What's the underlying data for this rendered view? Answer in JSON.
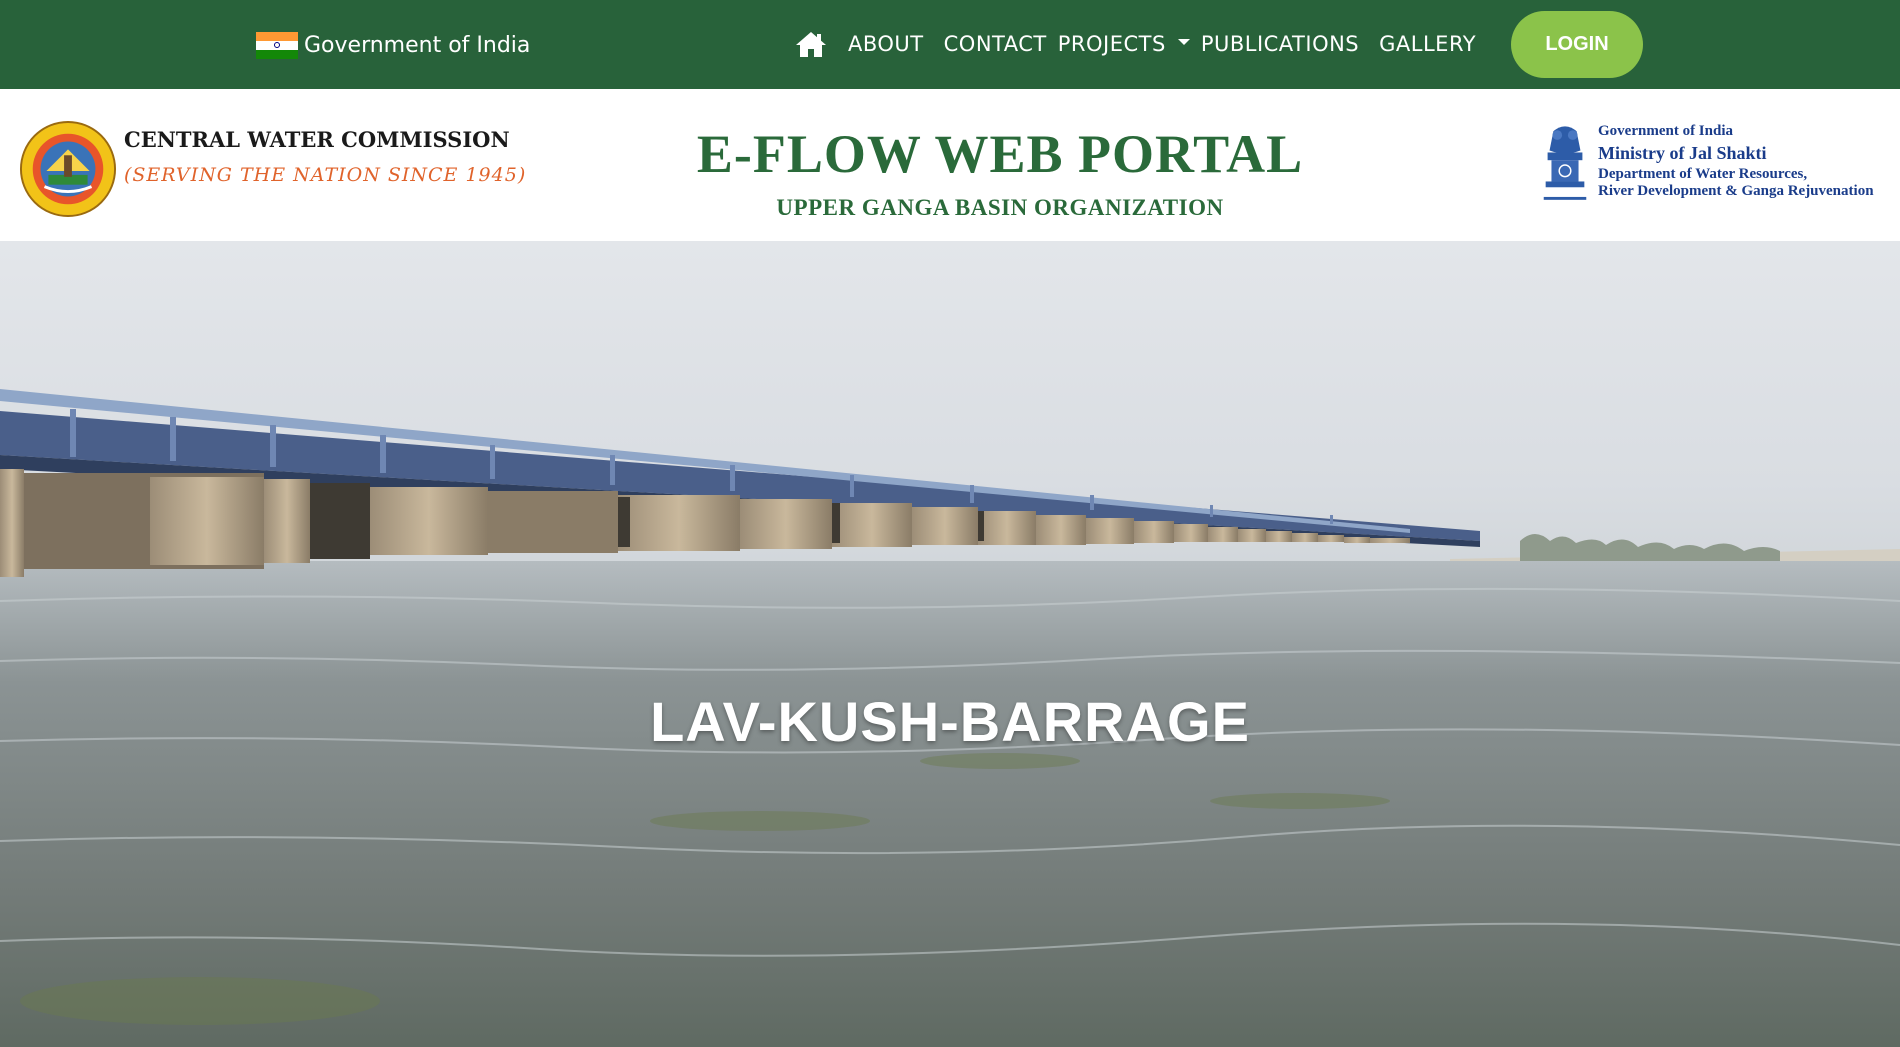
{
  "topbar": {
    "gov_label": "Government of India",
    "nav": {
      "about": "ABOUT",
      "contact": "CONTACT",
      "projects": "PROJECTS",
      "publications": "PUBLICATIONS",
      "gallery": "GALLERY"
    },
    "login_label": "LOGIN",
    "background_color": "#28623a",
    "login_color": "#8bc34a"
  },
  "header": {
    "org_name": "CENTRAL WATER COMMISSION",
    "org_tagline": "(SERVING THE NATION SINCE 1945)",
    "portal_title": "E-FLOW WEB PORTAL",
    "portal_subtitle": "UPPER GANGA BASIN ORGANIZATION",
    "ministry": {
      "line1": "Government of India",
      "line2": "Ministry of Jal Shakti",
      "line3": "Department of Water Resources,",
      "line4": "River Development & Ganga Rejuvenation"
    },
    "title_color": "#2a6a3a",
    "tagline_color": "#e0632b",
    "ministry_color": "#1a3c8a"
  },
  "hero": {
    "caption": "LAV-KUSH-BARRAGE"
  },
  "icons": {
    "home": "home-icon",
    "projects_dropdown": "caret-down-icon",
    "cwc_logo": "cwc-logo",
    "emblem": "national-emblem"
  }
}
